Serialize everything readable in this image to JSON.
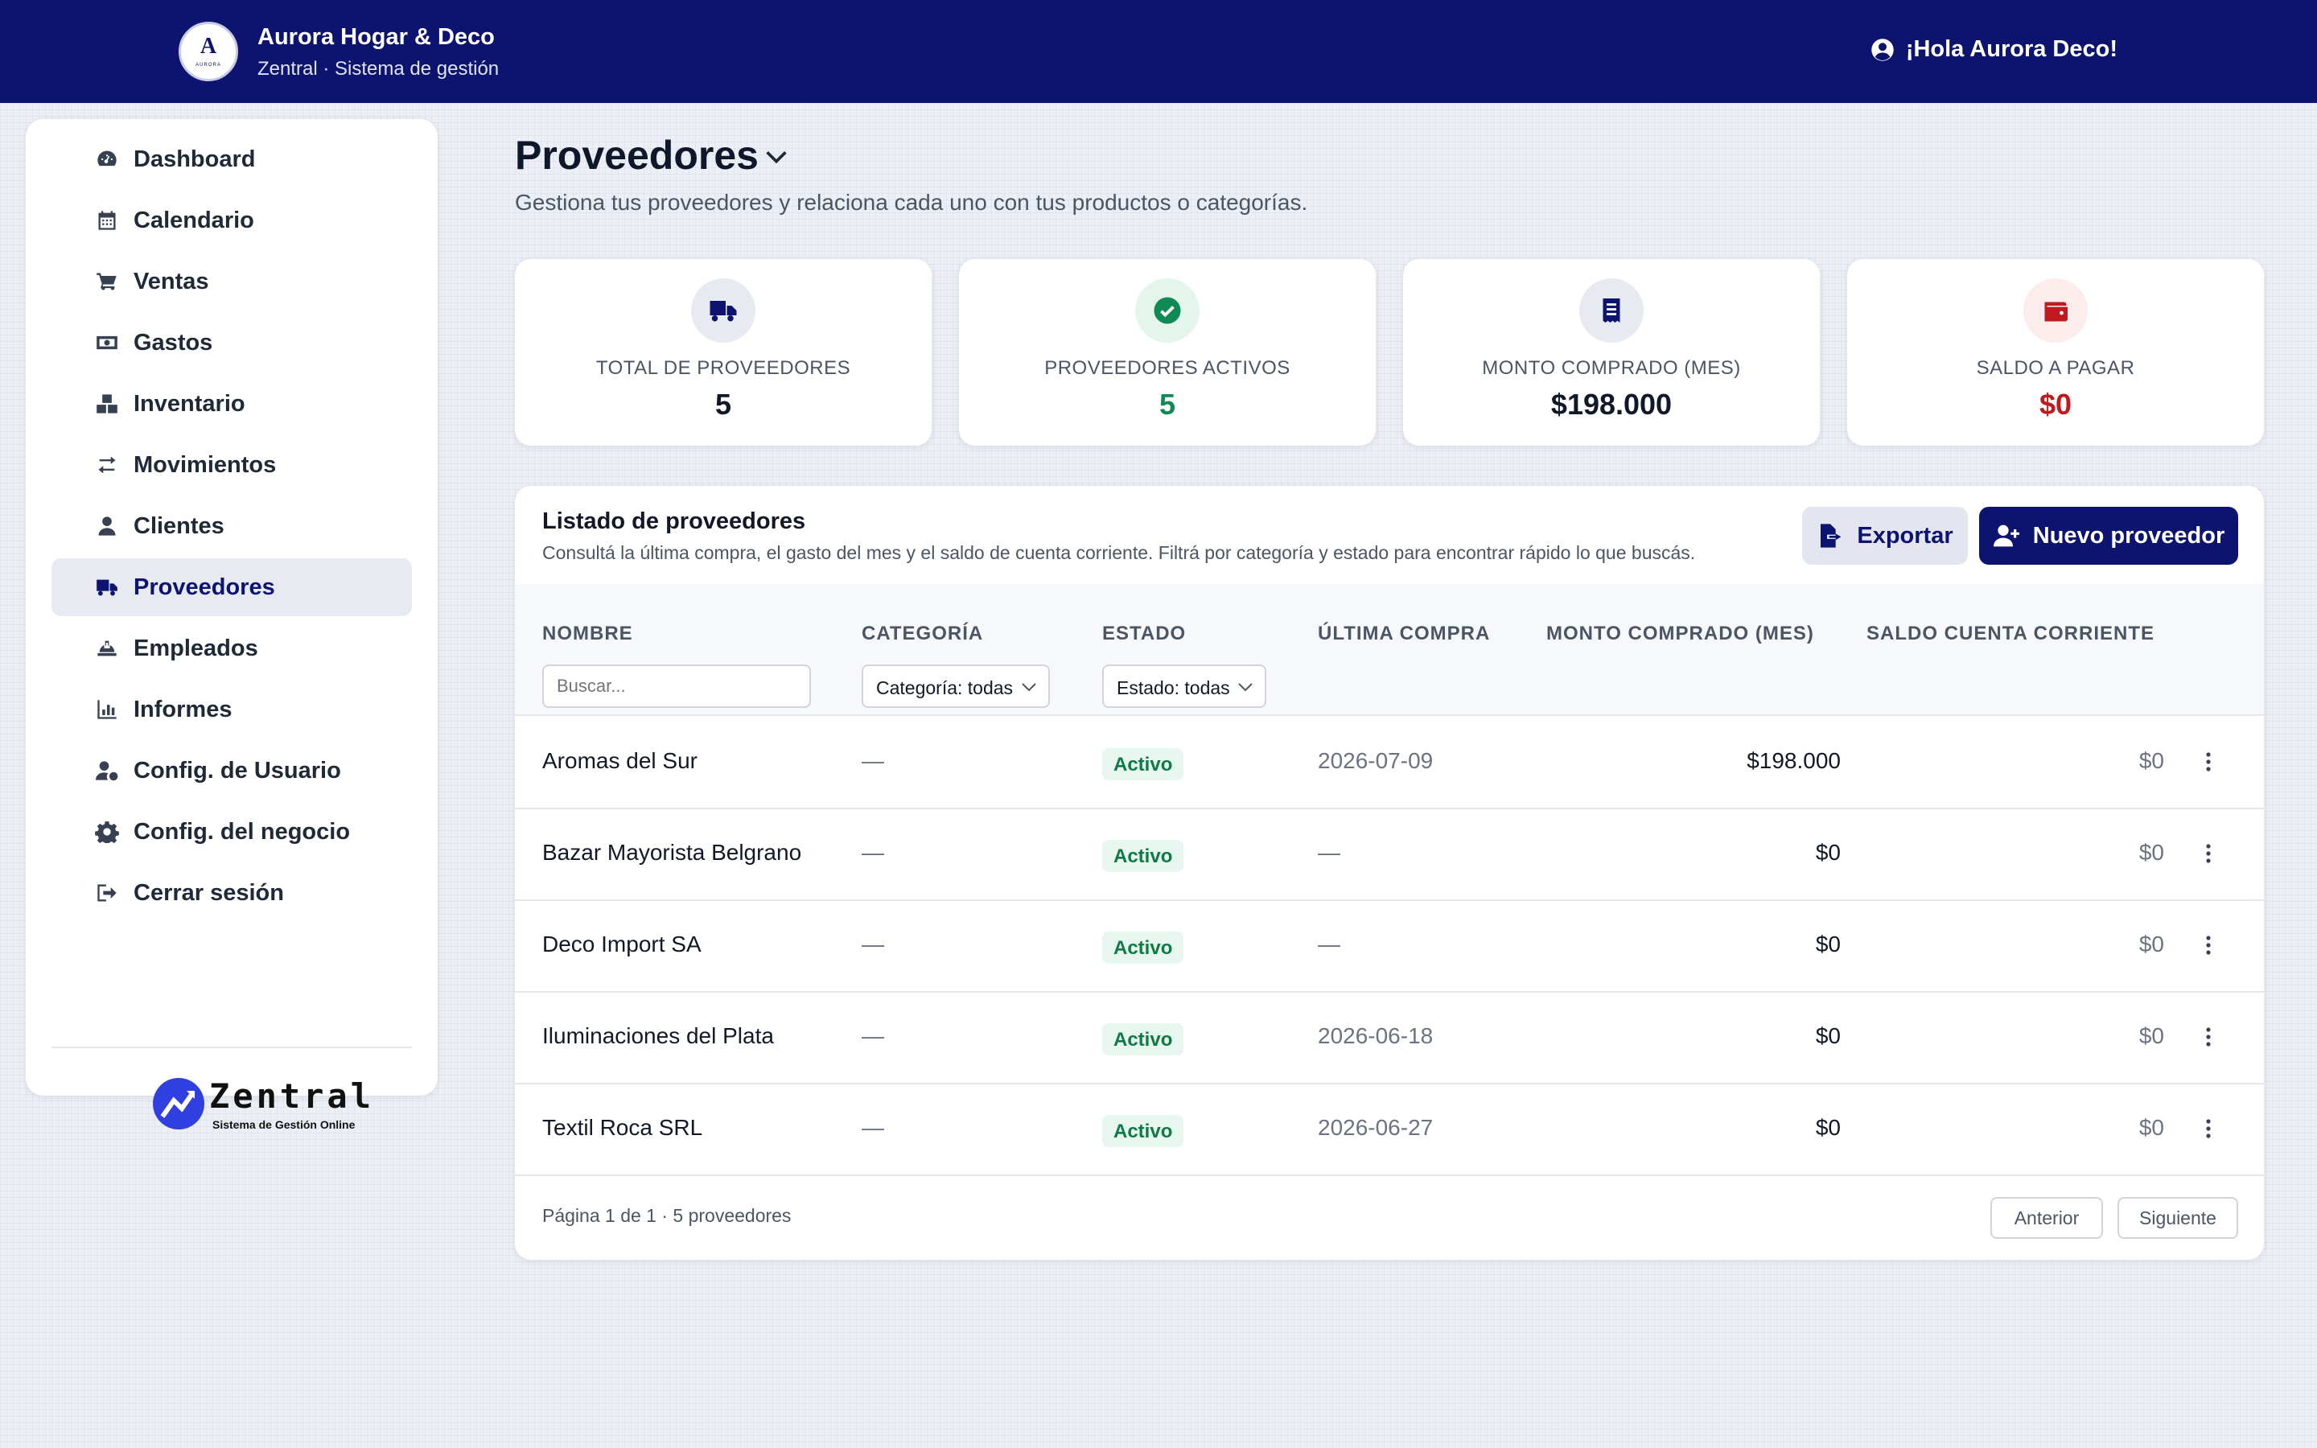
{
  "header": {
    "logo_letter": "A",
    "logo_small_text": "AURORA",
    "brand_name": "Aurora Hogar & Deco",
    "brand_subtitle": "Zentral · Sistema de gestión",
    "greeting": "¡Hola Aurora Deco!",
    "greeting_icon": "user-circle-icon"
  },
  "sidebar": {
    "items": [
      {
        "label": "Dashboard",
        "icon": "gauge-icon"
      },
      {
        "label": "Calendario",
        "icon": "calendar-icon"
      },
      {
        "label": "Ventas",
        "icon": "cart-icon"
      },
      {
        "label": "Gastos",
        "icon": "money-icon"
      },
      {
        "label": "Inventario",
        "icon": "boxes-icon"
      },
      {
        "label": "Movimientos",
        "icon": "arrows-icon"
      },
      {
        "label": "Clientes",
        "icon": "user-icon"
      },
      {
        "label": "Proveedores",
        "icon": "truck-icon",
        "active": true
      },
      {
        "label": "Empleados",
        "icon": "hardhat-icon"
      },
      {
        "label": "Informes",
        "icon": "chart-icon"
      },
      {
        "label": "Config. de Usuario",
        "icon": "user-gear-icon"
      },
      {
        "label": "Config. del negocio",
        "icon": "gear-icon"
      },
      {
        "label": "Cerrar sesión",
        "icon": "logout-icon"
      }
    ],
    "footer_logo": {
      "word": "Zentral",
      "tagline": "Sistema de Gestión Online"
    }
  },
  "page": {
    "title": "Proveedores",
    "description": "Gestiona tus proveedores y relaciona cada uno con tus productos o categorías."
  },
  "stats": [
    {
      "label": "TOTAL DE PROVEEDORES",
      "value": "5",
      "icon": "truck-icon",
      "color": "#111827"
    },
    {
      "label": "PROVEEDORES ACTIVOS",
      "value": "5",
      "icon": "check-circle-icon",
      "color": "#0f8a55"
    },
    {
      "label": "MONTO COMPRADO (MES)",
      "value": "$198.000",
      "icon": "receipt-icon",
      "color": "#111827"
    },
    {
      "label": "SALDO A PAGAR",
      "value": "$0",
      "icon": "wallet-icon",
      "color": "#c0191f"
    }
  ],
  "table": {
    "title": "Listado de proveedores",
    "subtitle": "Consultá la última compra, el gasto del mes y el saldo de cuenta corriente. Filtrá por categoría y estado para encontrar rápido lo que buscás.",
    "export_label": "Exportar",
    "new_label": "Nuevo proveedor",
    "columns": [
      "NOMBRE",
      "CATEGORÍA",
      "ESTADO",
      "ÚLTIMA COMPRA",
      "MONTO COMPRADO (MES)",
      "SALDO CUENTA CORRIENTE"
    ],
    "filters": {
      "search_placeholder": "Buscar...",
      "category": "Categoría: todas",
      "status": "Estado: todas"
    },
    "rows": [
      {
        "name": "Aromas del Sur",
        "category": "—",
        "status": "Activo",
        "last_purchase": "2026-07-09",
        "amount": "$198.000",
        "balance": "$0"
      },
      {
        "name": "Bazar Mayorista Belgrano",
        "category": "—",
        "status": "Activo",
        "last_purchase": "—",
        "amount": "$0",
        "balance": "$0"
      },
      {
        "name": "Deco Import SA",
        "category": "—",
        "status": "Activo",
        "last_purchase": "—",
        "amount": "$0",
        "balance": "$0"
      },
      {
        "name": "Iluminaciones del Plata",
        "category": "—",
        "status": "Activo",
        "last_purchase": "2026-06-18",
        "amount": "$0",
        "balance": "$0"
      },
      {
        "name": "Textil Roca SRL",
        "category": "—",
        "status": "Activo",
        "last_purchase": "2026-06-27",
        "amount": "$0",
        "balance": "$0"
      }
    ],
    "footer": {
      "page_info": "Página 1 de 1 · 5 proveedores",
      "prev_label": "Anterior",
      "next_label": "Siguiente"
    }
  }
}
